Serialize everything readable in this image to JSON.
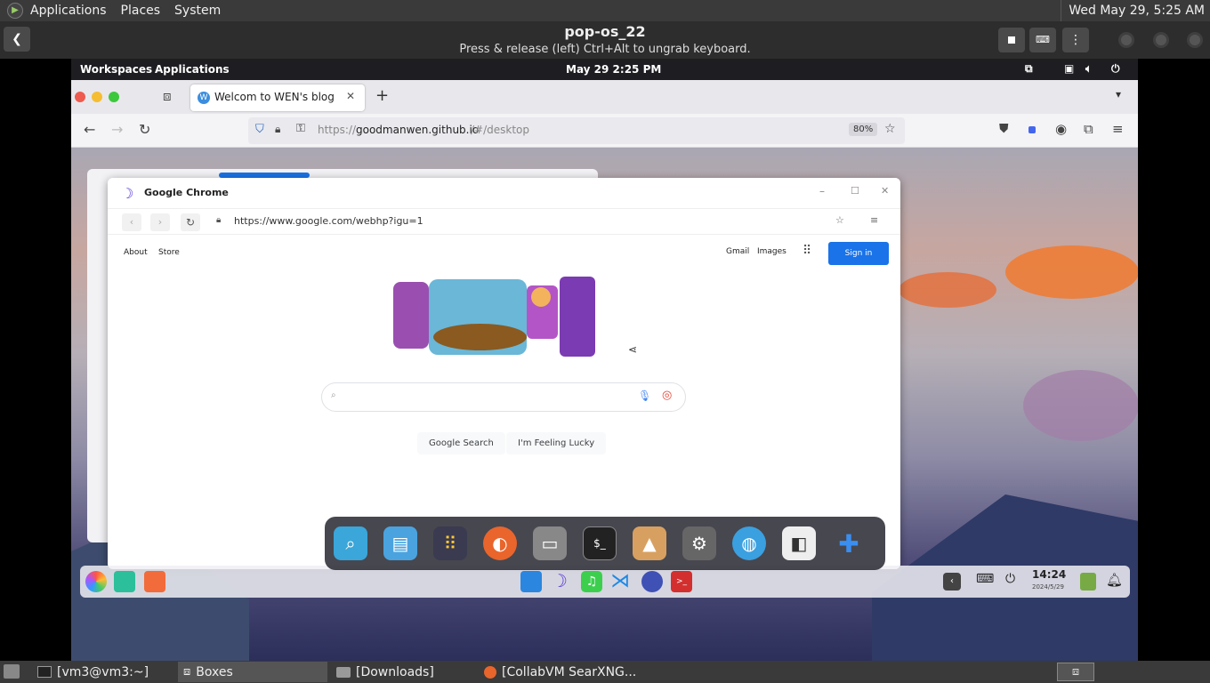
{
  "host_panel": {
    "menu": [
      "Applications",
      "Places",
      "System"
    ],
    "clock": "Wed May 29,  5:25 AM"
  },
  "boxes": {
    "title": "pop-os_22",
    "subtitle": "Press & release (left) Ctrl+Alt to ungrab keyboard."
  },
  "vm_panel": {
    "workspaces": "Workspaces",
    "applications": "Applications",
    "clock": "May 29   2:25 PM"
  },
  "firefox": {
    "tab_title": "Welcom to WEN's blog",
    "url_prefix": "https://",
    "url_host": "goodmanwen.github.io",
    "url_rest": "/#/desktop",
    "zoom": "80%"
  },
  "chrome": {
    "title": "Google Chrome",
    "url": "https://www.google.com/webhp?igu=1",
    "top_left_links": [
      "About",
      "Store"
    ],
    "top_right_links": [
      "Gmail",
      "Images"
    ],
    "sign_in": "Sign in",
    "search_button": "Google Search",
    "lucky_button": "I'm Feeling Lucky"
  },
  "vm_taskbar": {
    "time": "14:24",
    "date": "2024/5/29"
  },
  "host_tasks": [
    {
      "label": "[vm3@vm3:~]",
      "icon": "terminal-icon"
    },
    {
      "label": "Boxes",
      "icon": "boxes-icon"
    },
    {
      "label": "[Downloads]",
      "icon": "folder-icon"
    },
    {
      "label": "[CollabVM SearXNG...",
      "icon": "firefox-icon"
    }
  ]
}
